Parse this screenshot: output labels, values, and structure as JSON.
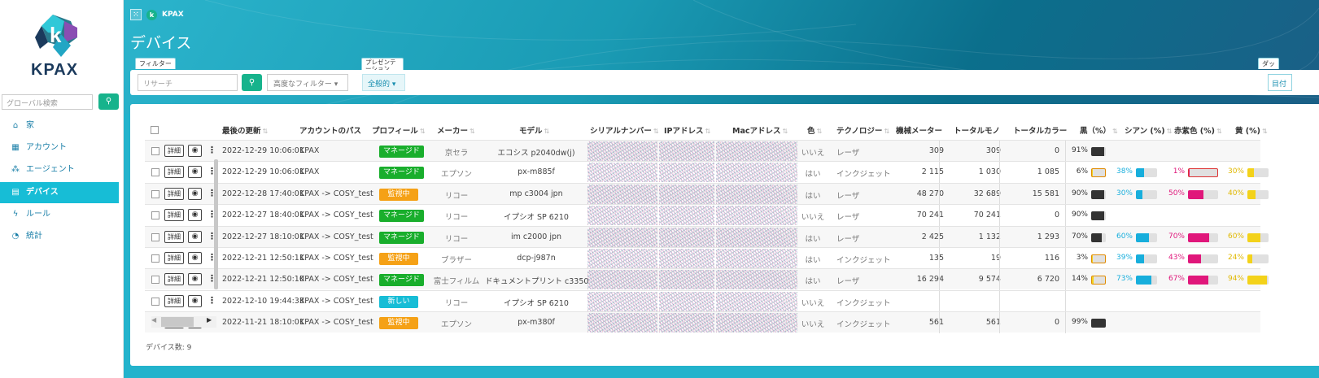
{
  "app": {
    "name": "KPAX"
  },
  "sidebar": {
    "logo_text": "KPAX",
    "search_placeholder": "グローバル検索",
    "items": [
      {
        "label": "家",
        "icon": "home-icon"
      },
      {
        "label": "アカウント",
        "icon": "building-icon"
      },
      {
        "label": "エージェント",
        "icon": "agents-icon"
      },
      {
        "label": "デバイス",
        "icon": "printer-icon",
        "active": true
      },
      {
        "label": "ルール",
        "icon": "bolt-icon"
      },
      {
        "label": "統計",
        "icon": "pie-chart-icon"
      }
    ]
  },
  "header": {
    "breadcrumb": "KPAX",
    "title": "デバイス"
  },
  "filters": {
    "filter_tag": "フィルター",
    "presentation_tag": "プレゼンテーション",
    "dashboard_tag": "ダッ",
    "search_placeholder": "リサーチ",
    "advanced": "高度なフィルター",
    "presentation_value": "全般的",
    "dashboard_value": "目付"
  },
  "table": {
    "headers": [
      "最後の更新",
      "アカウントのパス",
      "プロフィール",
      "メーカー",
      "モデル",
      "シリアルナンバー",
      "IPアドレス",
      "Macアドレス",
      "色",
      "テクノロジー",
      "機械メーター",
      "トータルモノ",
      "トータルカラー",
      "黒（%）",
      "シアン (%)",
      "赤紫色 (%)",
      "黄 (%)"
    ],
    "detail_label": "詳細",
    "rows": [
      {
        "date": "2022-12-29 10:06:01",
        "path": "KPAX",
        "profile": "マネージド",
        "profile_type": "green",
        "maker": "京セラ",
        "model": "エコシス p2040dw(j)",
        "color": "いいえ",
        "tech": "レーザ",
        "meter": "309",
        "mono": "309",
        "total_color": "0",
        "black": "91%",
        "black_val": 91,
        "cyan": "",
        "magenta": "",
        "yellow": ""
      },
      {
        "date": "2022-12-29 10:06:01",
        "path": "KPAX",
        "profile": "マネージド",
        "profile_type": "green",
        "maker": "エプソン",
        "model": "px-m885f",
        "color": "はい",
        "tech": "インクジェット",
        "meter": "2 115",
        "mono": "1 030",
        "total_color": "1 085",
        "black": "6%",
        "black_val": 6,
        "cyan": "38%",
        "cyan_val": 38,
        "magenta": "1%",
        "magenta_val": 1,
        "yellow": "30%",
        "yellow_val": 30
      },
      {
        "date": "2022-12-28 17:40:01",
        "path": "KPAX -> COSY_test",
        "profile": "監視中",
        "profile_type": "orange",
        "maker": "リコー",
        "model": "mp c3004 jpn",
        "color": "はい",
        "tech": "レーザ",
        "meter": "48 270",
        "mono": "32 689",
        "total_color": "15 581",
        "black": "90%",
        "black_val": 90,
        "cyan": "30%",
        "cyan_val": 30,
        "magenta": "50%",
        "magenta_val": 50,
        "yellow": "40%",
        "yellow_val": 40
      },
      {
        "date": "2022-12-27 18:40:01",
        "path": "KPAX -> COSY_test",
        "profile": "マネージド",
        "profile_type": "green",
        "maker": "リコー",
        "model": "イプシオ SP 6210",
        "color": "いいえ",
        "tech": "レーザ",
        "meter": "70 241",
        "mono": "70 241",
        "total_color": "0",
        "black": "90%",
        "black_val": 90,
        "cyan": "",
        "magenta": "",
        "yellow": ""
      },
      {
        "date": "2022-12-27 18:10:01",
        "path": "KPAX -> COSY_test",
        "profile": "マネージド",
        "profile_type": "green",
        "maker": "リコー",
        "model": "im c2000 jpn",
        "color": "はい",
        "tech": "レーザ",
        "meter": "2 425",
        "mono": "1 132",
        "total_color": "1 293",
        "black": "70%",
        "black_val": 70,
        "cyan": "60%",
        "cyan_val": 60,
        "magenta": "70%",
        "magenta_val": 70,
        "yellow": "60%",
        "yellow_val": 60
      },
      {
        "date": "2022-12-21 12:50:11",
        "path": "KPAX -> COSY_test",
        "profile": "監視中",
        "profile_type": "orange",
        "maker": "ブラザー",
        "model": "dcp-j987n",
        "color": "はい",
        "tech": "インクジェット",
        "meter": "135",
        "mono": "19",
        "total_color": "116",
        "black": "3%",
        "black_val": 3,
        "cyan": "39%",
        "cyan_val": 39,
        "magenta": "43%",
        "magenta_val": 43,
        "yellow": "24%",
        "yellow_val": 24
      },
      {
        "date": "2022-12-21 12:50:10",
        "path": "KPAX -> COSY_test",
        "profile": "マネージド",
        "profile_type": "green",
        "maker": "富士フィルム",
        "model": "ドキュメントプリント c3350",
        "color": "はい",
        "tech": "レーザ",
        "meter": "16 294",
        "mono": "9 574",
        "total_color": "6 720",
        "black": "14%",
        "black_val": 14,
        "cyan": "73%",
        "cyan_val": 73,
        "magenta": "67%",
        "magenta_val": 67,
        "yellow": "94%",
        "yellow_val": 94
      },
      {
        "date": "2022-12-10 19:44:33",
        "path": "KPAX -> COSY_test",
        "profile": "新しい",
        "profile_type": "cyan",
        "maker": "リコー",
        "model": "イプシオ SP 6210",
        "color": "いいえ",
        "tech": "インクジェット",
        "meter": "",
        "mono": "",
        "total_color": "",
        "black": "",
        "cyan": "",
        "magenta": "",
        "yellow": ""
      },
      {
        "date": "2022-11-21 18:10:01",
        "path": "KPAX -> COSY_test",
        "profile": "監視中",
        "profile_type": "orange",
        "maker": "エプソン",
        "model": "px-m380f",
        "color": "いいえ",
        "tech": "インクジェット",
        "meter": "561",
        "mono": "561",
        "total_color": "0",
        "black": "99%",
        "black_val": 99,
        "cyan": "",
        "magenta": "",
        "yellow": ""
      }
    ]
  },
  "footer": {
    "count": "デバイス数: 9"
  },
  "colors": {
    "accent": "#17bdd6",
    "green": "#19ae2c",
    "orange": "#f5a116",
    "black_bar": "#333333",
    "cyan_bar": "#17aedc",
    "magenta_bar": "#e0177b",
    "yellow_bar": "#f3d21a"
  }
}
